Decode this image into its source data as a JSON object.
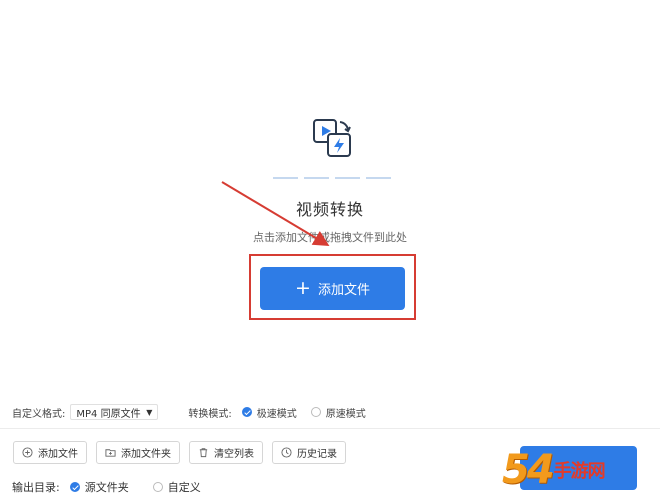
{
  "center": {
    "icon": "video-convert-icon",
    "title": "视频转换",
    "hint": "点击添加文件或拖拽文件到此处",
    "add_button_label": "添加文件"
  },
  "options": {
    "format_label": "自定义格式:",
    "format_value": "MP4 同原文件",
    "mode_label": "转换模式:",
    "modes": [
      {
        "label": "极速模式",
        "checked": true
      },
      {
        "label": "原速模式",
        "checked": false
      }
    ]
  },
  "toolbar": {
    "add_file": "添加文件",
    "add_folder": "添加文件夹",
    "clear_list": "清空列表",
    "history": "历史记录"
  },
  "output": {
    "label": "输出目录:",
    "options": [
      {
        "label": "源文件夹",
        "checked": true
      },
      {
        "label": "自定义",
        "checked": false
      }
    ]
  },
  "colors": {
    "accent": "#2e7ce6",
    "highlight": "#d63c33"
  },
  "watermark": {
    "logo": "54",
    "text": "手游网"
  }
}
